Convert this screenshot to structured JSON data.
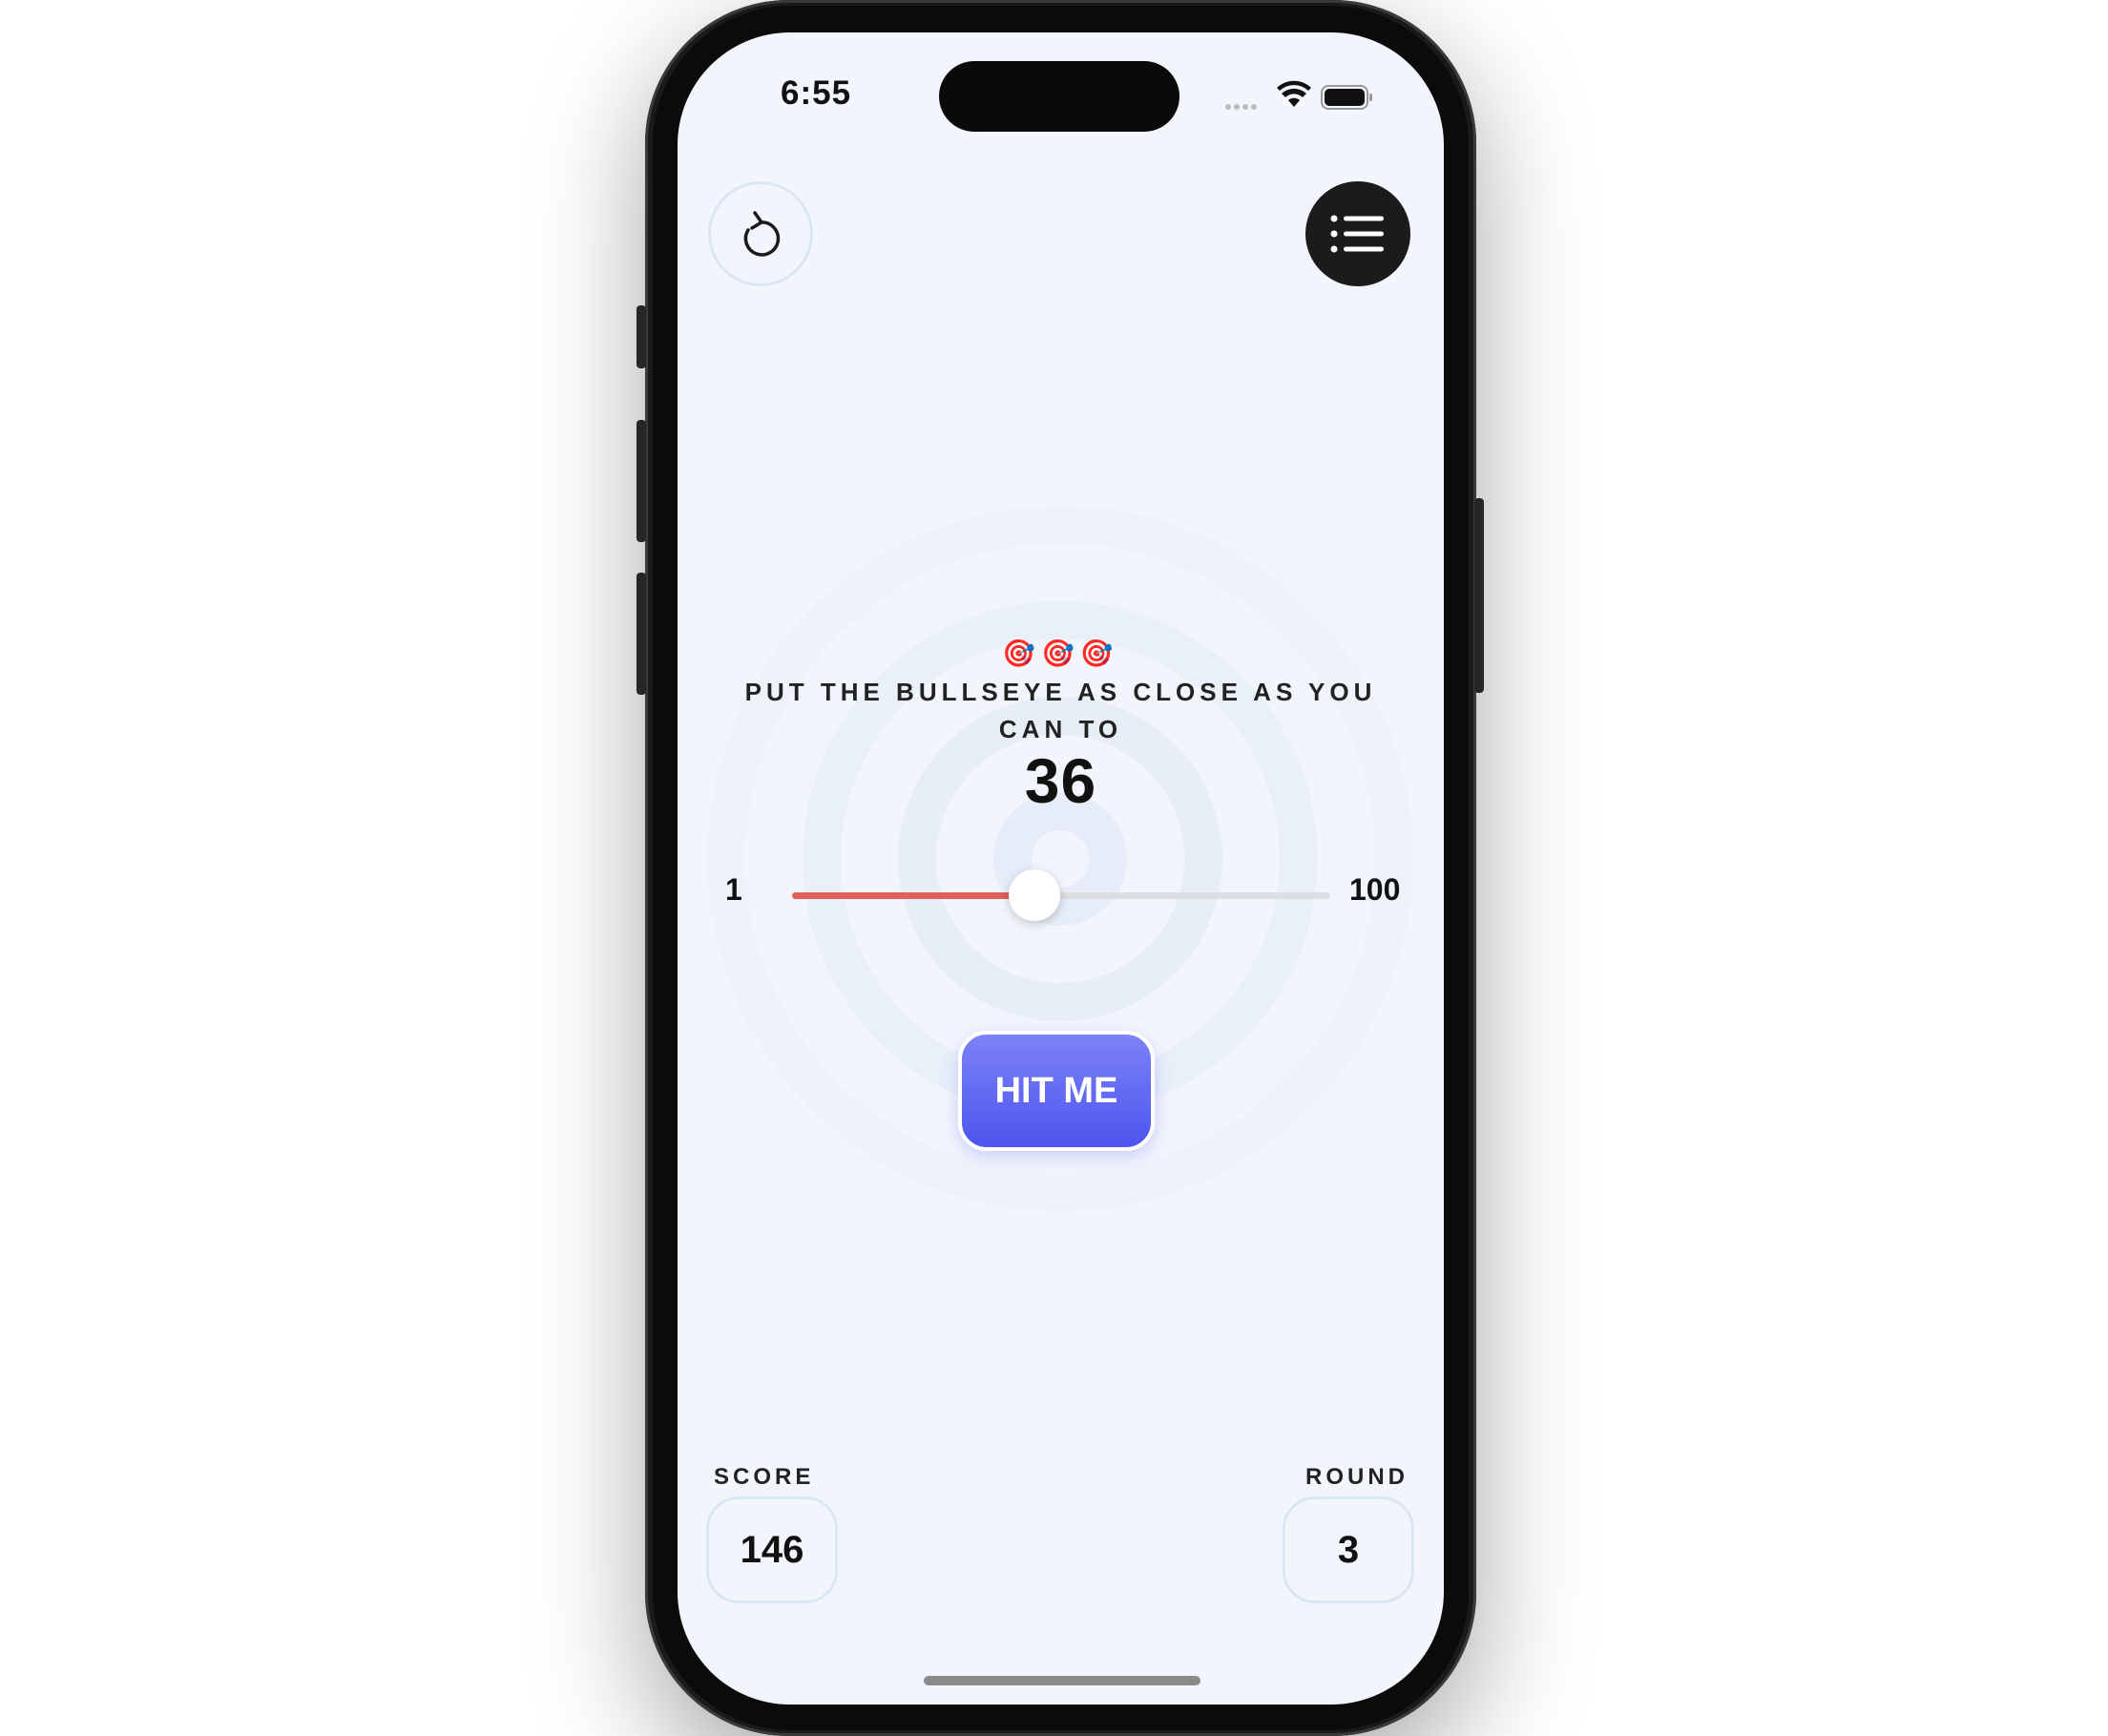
{
  "status_bar": {
    "time": "6:55"
  },
  "game": {
    "target_emojis": "🎯🎯🎯",
    "instructions": "PUT THE BULLSEYE AS CLOSE AS YOU CAN TO",
    "target_value": "36",
    "slider": {
      "min_label": "1",
      "max_label": "100",
      "value_fraction": 0.45
    },
    "hit_button_label": "HIT ME"
  },
  "stats": {
    "score_label": "SCORE",
    "score_value": "146",
    "round_label": "ROUND",
    "round_value": "3"
  },
  "colors": {
    "accent": "#5058F0",
    "slider_fill": "#E0605A",
    "background": "#F2F6FC"
  },
  "icons": {
    "restart": "restart-icon",
    "leaderboard": "list-icon"
  }
}
